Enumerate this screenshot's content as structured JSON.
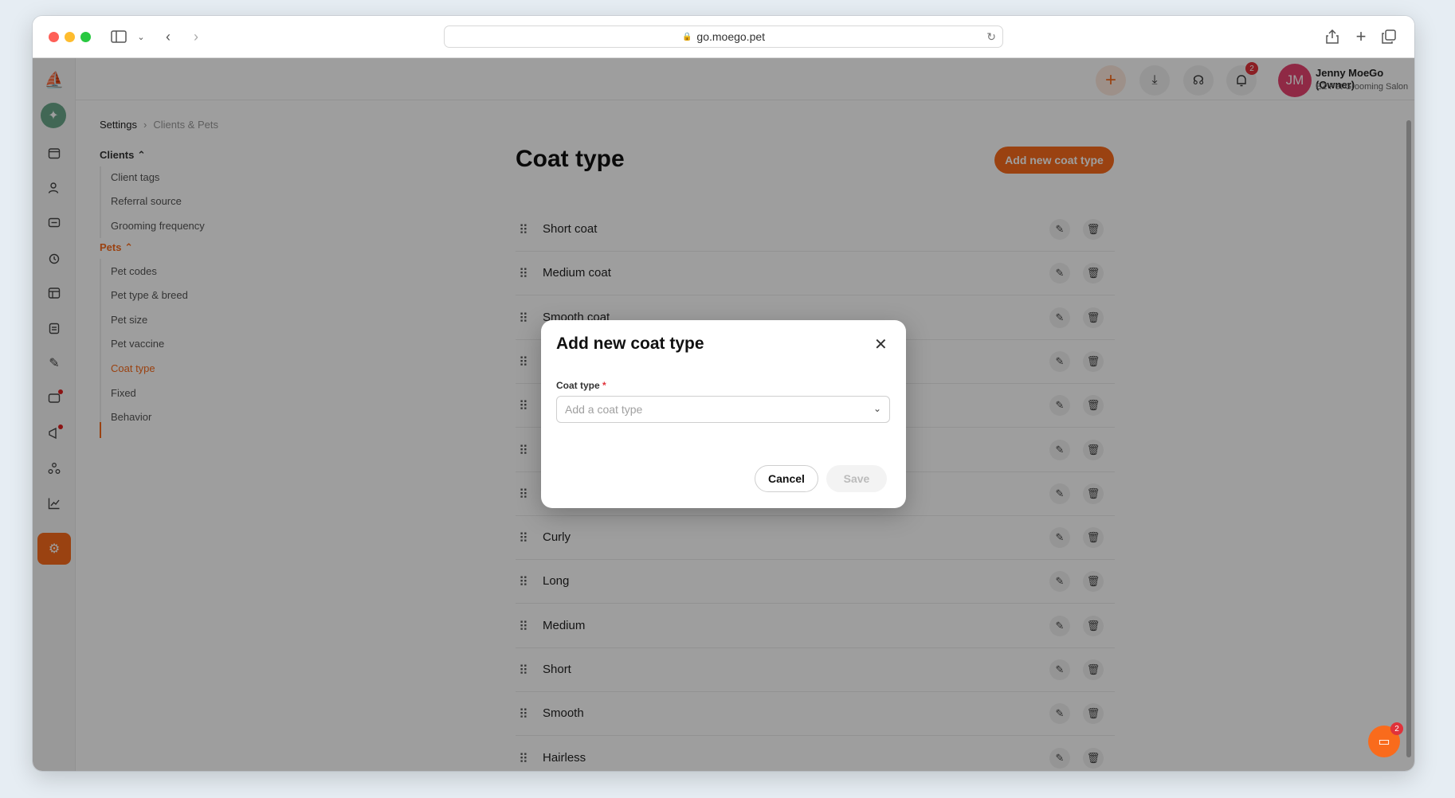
{
  "browser": {
    "url": "go.moego.pet"
  },
  "header": {
    "user_initials": "JM",
    "user_name": "Jenny MoeGo (Owner)",
    "business_name": "EZ Pet Grooming Salon",
    "notification_count": "2"
  },
  "breadcrumb": {
    "root": "Settings",
    "current": "Clients & Pets"
  },
  "settings_nav": {
    "clients_label": "Clients",
    "clients_items": [
      "Client tags",
      "Referral source",
      "Grooming frequency"
    ],
    "pets_label": "Pets",
    "pets_items": [
      "Pet codes",
      "Pet type & breed",
      "Pet size",
      "Pet vaccine",
      "Coat type",
      "Fixed",
      "Behavior"
    ],
    "active_item": "Coat type"
  },
  "main": {
    "title": "Coat type",
    "add_button": "Add new coat type",
    "rows": [
      "Short coat",
      "Medium coat",
      "Smooth coat",
      "",
      "",
      "",
      "",
      "Curly",
      "Long",
      "Medium",
      "Short",
      "Smooth",
      "Hairless"
    ]
  },
  "modal": {
    "title": "Add new coat type",
    "field_label": "Coat type",
    "required_mark": "*",
    "placeholder": "Add a coat type",
    "cancel": "Cancel",
    "save": "Save"
  },
  "chat": {
    "badge": "2"
  },
  "colors": {
    "accent": "#f96b1c",
    "badge": "#e0323a",
    "avatar": "#e74370"
  }
}
